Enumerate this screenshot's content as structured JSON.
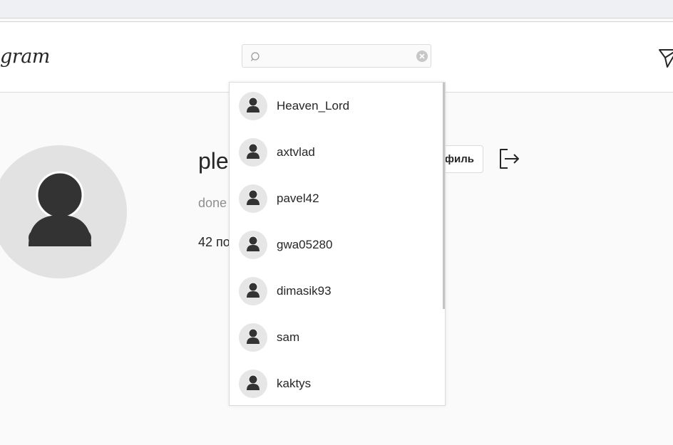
{
  "header": {
    "logo_text": "gram",
    "search": {
      "value": "",
      "placeholder": ""
    }
  },
  "profile": {
    "username": "ple",
    "edit_button_label": "филь",
    "bio": "done",
    "stats_number": "42",
    "stats_label": "по"
  },
  "search_results": [
    {
      "username": "Heaven_Lord"
    },
    {
      "username": "axtvlad"
    },
    {
      "username": "pavel42"
    },
    {
      "username": "gwa05280"
    },
    {
      "username": "dimasik93"
    },
    {
      "username": "sam"
    },
    {
      "username": "kaktys"
    }
  ],
  "icons": {
    "search": "search-icon",
    "clear": "clear-icon",
    "direct": "paper-plane-icon",
    "logout": "logout-icon",
    "avatar": "user-silhouette-icon"
  }
}
